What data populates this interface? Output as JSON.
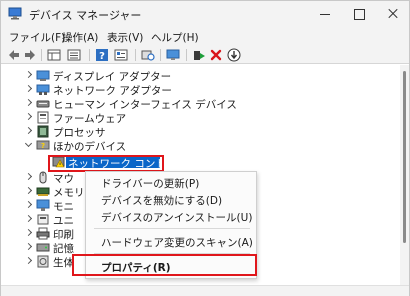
{
  "window": {
    "title": "デバイス マネージャー"
  },
  "menubar": {
    "items": [
      "ファイル(F)",
      "操作(A)",
      "表示(V)",
      "ヘルプ(H)"
    ]
  },
  "toolbar": {
    "icons": [
      "back-arrow-icon",
      "forward-arrow-icon",
      "properties-grid-icon",
      "list-icon",
      "help-icon",
      "device-list-icon",
      "scan-hardware-icon",
      "monitor-icon",
      "add-driver-icon",
      "uninstall-x-icon",
      "update-down-arrow-icon"
    ]
  },
  "tree": {
    "items": [
      {
        "label": "ディスプレイ アダプター",
        "icon": "display-adapter-icon",
        "expanded": false
      },
      {
        "label": "ネットワーク アダプター",
        "icon": "network-adapter-icon",
        "expanded": false
      },
      {
        "label": "ヒューマン インターフェイス デバイス",
        "icon": "hid-icon",
        "expanded": false
      },
      {
        "label": "ファームウェア",
        "icon": "firmware-icon",
        "expanded": false
      },
      {
        "label": "プロセッサ",
        "icon": "processor-icon",
        "expanded": false
      },
      {
        "label": "ほかのデバイス",
        "icon": "other-devices-icon",
        "expanded": true
      },
      {
        "label": "ネットワーク コントローラー",
        "icon": "warning-device-icon",
        "selected": true
      },
      {
        "label": "マウ",
        "icon": "mouse-icon",
        "expanded": false
      },
      {
        "label": "メモリ",
        "icon": "memory-icon",
        "expanded": false
      },
      {
        "label": "モニ",
        "icon": "monitor-device-icon",
        "expanded": false
      },
      {
        "label": "ユニ",
        "icon": "usb-icon",
        "expanded": false
      },
      {
        "label": "印刷",
        "icon": "printer-icon",
        "expanded": false
      },
      {
        "label": "記憶",
        "icon": "storage-icon",
        "expanded": false
      },
      {
        "label": "生体",
        "icon": "biometric-icon",
        "expanded": false
      }
    ]
  },
  "context_menu": {
    "items": [
      "ドライバーの更新(P)",
      "デバイスを無効にする(D)",
      "デバイスのアンインストール(U)",
      "ハードウェア変更のスキャン(A)",
      "プロパティ(R)"
    ]
  },
  "colors": {
    "highlight": "#e0161b",
    "selection": "#0a66c8"
  }
}
